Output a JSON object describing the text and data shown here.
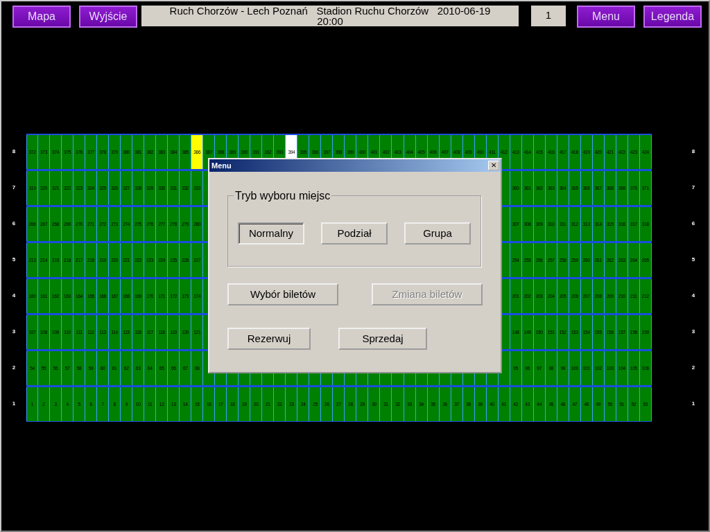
{
  "toolbar": {
    "left_buttons": [
      "Mapa",
      "Wyjście"
    ],
    "event_info": "Ruch Chorzów - Lech Poznań   Stadion Ruchu Chorzów   2010-06-19 20:00",
    "sector": "1",
    "right_buttons": [
      "Menu",
      "Legenda"
    ]
  },
  "seat_rows": [
    {
      "left_label": "8",
      "right_label": "8",
      "left_seats": [
        {
          "number": "372",
          "color": "#008000"
        },
        {
          "number": "373",
          "color": "#008000"
        },
        {
          "number": "374",
          "color": "#008000"
        },
        {
          "number": "375",
          "color": "#008000"
        },
        {
          "number": "376",
          "color": "#008000"
        },
        {
          "number": "377",
          "color": "#008000"
        },
        {
          "number": "378",
          "color": "#008000"
        },
        {
          "number": "379",
          "color": "#008000"
        },
        {
          "number": "380",
          "color": "#008000"
        },
        {
          "number": "381",
          "color": "#008000"
        },
        {
          "number": "382",
          "color": "#008000"
        },
        {
          "number": "383",
          "color": "#008000"
        },
        {
          "number": "384",
          "color": "#008000"
        },
        {
          "number": "385",
          "color": "#008000"
        },
        {
          "number": "386",
          "color": "#ffff00"
        },
        {
          "number": "387",
          "color": "#008000"
        },
        {
          "number": "388",
          "color": "#008000"
        },
        {
          "number": "389",
          "color": "#008000"
        },
        {
          "number": "390",
          "color": "#008000"
        },
        {
          "number": "391",
          "color": "#008000"
        },
        {
          "number": "392",
          "color": "#008000"
        },
        {
          "number": "393",
          "color": "#008000"
        },
        {
          "number": "394",
          "color": "#ffffff"
        },
        {
          "number": "395",
          "color": "#008000"
        },
        {
          "number": "396",
          "color": "#008000"
        },
        {
          "number": "397",
          "color": "#008000"
        },
        {
          "number": "398",
          "color": "#008000"
        },
        {
          "number": "399",
          "color": "#008000"
        },
        {
          "number": "400",
          "color": "#008000"
        },
        {
          "number": "401",
          "color": "#008000"
        },
        {
          "number": "402",
          "color": "#008000"
        },
        {
          "number": "403",
          "color": "#008000"
        },
        {
          "number": "404",
          "color": "#008000"
        },
        {
          "number": "405",
          "color": "#008000"
        },
        {
          "number": "406",
          "color": "#008000"
        },
        {
          "number": "407",
          "color": "#008000"
        },
        {
          "number": "408",
          "color": "#008000"
        },
        {
          "number": "409",
          "color": "#008000"
        },
        {
          "number": "410",
          "color": "#008000"
        },
        {
          "number": "411",
          "color": "#008000"
        },
        {
          "number": "412",
          "color": "#008000"
        },
        {
          "number": "413",
          "color": "#008000"
        },
        {
          "number": "414",
          "color": "#008000"
        },
        {
          "number": "415",
          "color": "#008000"
        },
        {
          "number": "416",
          "color": "#008000"
        },
        {
          "number": "417",
          "color": "#008000"
        },
        {
          "number": "418",
          "color": "#008000"
        },
        {
          "number": "419",
          "color": "#008000"
        },
        {
          "number": "420",
          "color": "#008000"
        },
        {
          "number": "421",
          "color": "#008000"
        },
        {
          "number": "422",
          "color": "#008000"
        },
        {
          "number": "423",
          "color": "#008000"
        },
        {
          "number": "424",
          "color": "#008000"
        }
      ],
      "right_seats": []
    },
    {
      "left_label": "7",
      "right_label": "7",
      "left_seats": [
        {
          "number": "319",
          "color": "#008000"
        },
        {
          "number": "320",
          "color": "#008000"
        },
        {
          "number": "321",
          "color": "#008000"
        },
        {
          "number": "322",
          "color": "#008000"
        },
        {
          "number": "323",
          "color": "#008000"
        },
        {
          "number": "324",
          "color": "#008000"
        },
        {
          "number": "325",
          "color": "#008000"
        },
        {
          "number": "326",
          "color": "#008000"
        },
        {
          "number": "327",
          "color": "#008000"
        },
        {
          "number": "328",
          "color": "#008000"
        },
        {
          "number": "329",
          "color": "#008000"
        },
        {
          "number": "330",
          "color": "#008000"
        },
        {
          "number": "331",
          "color": "#008000"
        },
        {
          "number": "332",
          "color": "#008000"
        },
        {
          "number": "333",
          "color": "#008000"
        }
      ],
      "right_seats": [
        {
          "number": "360",
          "color": "#008000"
        },
        {
          "number": "361",
          "color": "#008000"
        },
        {
          "number": "362",
          "color": "#008000"
        },
        {
          "number": "363",
          "color": "#008000"
        },
        {
          "number": "364",
          "color": "#008000"
        },
        {
          "number": "365",
          "color": "#008000"
        },
        {
          "number": "366",
          "color": "#008000"
        },
        {
          "number": "367",
          "color": "#008000"
        },
        {
          "number": "368",
          "color": "#008000"
        },
        {
          "number": "369",
          "color": "#008000"
        },
        {
          "number": "370",
          "color": "#008000"
        },
        {
          "number": "371",
          "color": "#008000"
        }
      ]
    },
    {
      "left_label": "6",
      "right_label": "6",
      "left_seats": [
        {
          "number": "266",
          "color": "#008000"
        },
        {
          "number": "267",
          "color": "#008000"
        },
        {
          "number": "268",
          "color": "#008000"
        },
        {
          "number": "269",
          "color": "#008000"
        },
        {
          "number": "270",
          "color": "#008000"
        },
        {
          "number": "271",
          "color": "#008000"
        },
        {
          "number": "272",
          "color": "#008000"
        },
        {
          "number": "273",
          "color": "#008000"
        },
        {
          "number": "274",
          "color": "#008000"
        },
        {
          "number": "275",
          "color": "#008000"
        },
        {
          "number": "276",
          "color": "#008000"
        },
        {
          "number": "277",
          "color": "#008000"
        },
        {
          "number": "278",
          "color": "#008000"
        },
        {
          "number": "279",
          "color": "#008000"
        },
        {
          "number": "280",
          "color": "#008000"
        }
      ],
      "right_seats": [
        {
          "number": "307",
          "color": "#008000"
        },
        {
          "number": "308",
          "color": "#008000"
        },
        {
          "number": "309",
          "color": "#008000"
        },
        {
          "number": "310",
          "color": "#008000"
        },
        {
          "number": "311",
          "color": "#008000"
        },
        {
          "number": "312",
          "color": "#008000"
        },
        {
          "number": "313",
          "color": "#008000"
        },
        {
          "number": "314",
          "color": "#008000"
        },
        {
          "number": "315",
          "color": "#008000"
        },
        {
          "number": "316",
          "color": "#008000"
        },
        {
          "number": "317",
          "color": "#008000"
        },
        {
          "number": "318",
          "color": "#008000"
        }
      ]
    },
    {
      "left_label": "5",
      "right_label": "5",
      "left_seats": [
        {
          "number": "213",
          "color": "#008000"
        },
        {
          "number": "214",
          "color": "#008000"
        },
        {
          "number": "215",
          "color": "#008000"
        },
        {
          "number": "216",
          "color": "#008000"
        },
        {
          "number": "217",
          "color": "#008000"
        },
        {
          "number": "218",
          "color": "#008000"
        },
        {
          "number": "219",
          "color": "#008000"
        },
        {
          "number": "220",
          "color": "#008000"
        },
        {
          "number": "221",
          "color": "#008000"
        },
        {
          "number": "222",
          "color": "#008000"
        },
        {
          "number": "223",
          "color": "#008000"
        },
        {
          "number": "224",
          "color": "#008000"
        },
        {
          "number": "225",
          "color": "#008000"
        },
        {
          "number": "226",
          "color": "#008000"
        },
        {
          "number": "227",
          "color": "#008000"
        }
      ],
      "right_seats": [
        {
          "number": "254",
          "color": "#008000"
        },
        {
          "number": "255",
          "color": "#008000"
        },
        {
          "number": "256",
          "color": "#008000"
        },
        {
          "number": "257",
          "color": "#008000"
        },
        {
          "number": "258",
          "color": "#008000"
        },
        {
          "number": "259",
          "color": "#008000"
        },
        {
          "number": "260",
          "color": "#008000"
        },
        {
          "number": "261",
          "color": "#008000"
        },
        {
          "number": "262",
          "color": "#008000"
        },
        {
          "number": "263",
          "color": "#008000"
        },
        {
          "number": "264",
          "color": "#008000"
        },
        {
          "number": "265",
          "color": "#008000"
        }
      ]
    },
    {
      "left_label": "4",
      "right_label": "4",
      "left_seats": [
        {
          "number": "160",
          "color": "#008000"
        },
        {
          "number": "161",
          "color": "#008000"
        },
        {
          "number": "162",
          "color": "#008000"
        },
        {
          "number": "163",
          "color": "#008000"
        },
        {
          "number": "164",
          "color": "#008000"
        },
        {
          "number": "165",
          "color": "#008000"
        },
        {
          "number": "166",
          "color": "#008000"
        },
        {
          "number": "167",
          "color": "#008000"
        },
        {
          "number": "168",
          "color": "#008000"
        },
        {
          "number": "169",
          "color": "#008000"
        },
        {
          "number": "170",
          "color": "#008000"
        },
        {
          "number": "171",
          "color": "#008000"
        },
        {
          "number": "172",
          "color": "#008000"
        },
        {
          "number": "173",
          "color": "#008000"
        },
        {
          "number": "174",
          "color": "#008000"
        }
      ],
      "right_seats": [
        {
          "number": "201",
          "color": "#008000"
        },
        {
          "number": "202",
          "color": "#008000"
        },
        {
          "number": "203",
          "color": "#008000"
        },
        {
          "number": "204",
          "color": "#008000"
        },
        {
          "number": "205",
          "color": "#008000"
        },
        {
          "number": "206",
          "color": "#008000"
        },
        {
          "number": "207",
          "color": "#008000"
        },
        {
          "number": "208",
          "color": "#008000"
        },
        {
          "number": "209",
          "color": "#008000"
        },
        {
          "number": "210",
          "color": "#008000"
        },
        {
          "number": "211",
          "color": "#008000"
        },
        {
          "number": "212",
          "color": "#008000"
        }
      ]
    },
    {
      "left_label": "3",
      "right_label": "3",
      "left_seats": [
        {
          "number": "107",
          "color": "#008000"
        },
        {
          "number": "108",
          "color": "#008000"
        },
        {
          "number": "109",
          "color": "#008000"
        },
        {
          "number": "110",
          "color": "#008000"
        },
        {
          "number": "111",
          "color": "#008000"
        },
        {
          "number": "112",
          "color": "#008000"
        },
        {
          "number": "113",
          "color": "#008000"
        },
        {
          "number": "114",
          "color": "#008000"
        },
        {
          "number": "115",
          "color": "#008000"
        },
        {
          "number": "116",
          "color": "#008000"
        },
        {
          "number": "117",
          "color": "#008000"
        },
        {
          "number": "118",
          "color": "#008000"
        },
        {
          "number": "119",
          "color": "#008000"
        },
        {
          "number": "120",
          "color": "#008000"
        },
        {
          "number": "121",
          "color": "#008000"
        }
      ],
      "right_seats": [
        {
          "number": "148",
          "color": "#008000"
        },
        {
          "number": "149",
          "color": "#008000"
        },
        {
          "number": "150",
          "color": "#008000"
        },
        {
          "number": "151",
          "color": "#008000"
        },
        {
          "number": "152",
          "color": "#008000"
        },
        {
          "number": "153",
          "color": "#008000"
        },
        {
          "number": "154",
          "color": "#008000"
        },
        {
          "number": "155",
          "color": "#008000"
        },
        {
          "number": "156",
          "color": "#008000"
        },
        {
          "number": "157",
          "color": "#008000"
        },
        {
          "number": "158",
          "color": "#008000"
        },
        {
          "number": "159",
          "color": "#008000"
        }
      ]
    },
    {
      "left_label": "2",
      "right_label": "2",
      "left_seats": [
        {
          "number": "54",
          "color": "#008000"
        },
        {
          "number": "55",
          "color": "#008000"
        },
        {
          "number": "56",
          "color": "#008000"
        },
        {
          "number": "57",
          "color": "#008000"
        },
        {
          "number": "58",
          "color": "#008000"
        },
        {
          "number": "59",
          "color": "#008000"
        },
        {
          "number": "60",
          "color": "#008000"
        },
        {
          "number": "61",
          "color": "#008000"
        },
        {
          "number": "62",
          "color": "#008000"
        },
        {
          "number": "63",
          "color": "#008000"
        },
        {
          "number": "64",
          "color": "#008000"
        },
        {
          "number": "65",
          "color": "#008000"
        },
        {
          "number": "66",
          "color": "#008000"
        },
        {
          "number": "67",
          "color": "#008000"
        },
        {
          "number": "68",
          "color": "#008000"
        }
      ],
      "right_seats": [
        {
          "number": "95",
          "color": "#008000"
        },
        {
          "number": "96",
          "color": "#008000"
        },
        {
          "number": "97",
          "color": "#008000"
        },
        {
          "number": "98",
          "color": "#008000"
        },
        {
          "number": "99",
          "color": "#008000"
        },
        {
          "number": "100",
          "color": "#008000"
        },
        {
          "number": "101",
          "color": "#008000"
        },
        {
          "number": "102",
          "color": "#008000"
        },
        {
          "number": "103",
          "color": "#008000"
        },
        {
          "number": "104",
          "color": "#008000"
        },
        {
          "number": "105",
          "color": "#008000"
        },
        {
          "number": "106",
          "color": "#008000"
        }
      ]
    },
    {
      "left_label": "1",
      "right_label": "1",
      "left_seats": [
        {
          "number": "1",
          "color": "#008000"
        },
        {
          "number": "2",
          "color": "#008000"
        },
        {
          "number": "3",
          "color": "#008000"
        },
        {
          "number": "4",
          "color": "#008000"
        },
        {
          "number": "5",
          "color": "#008000"
        },
        {
          "number": "6",
          "color": "#008000"
        },
        {
          "number": "7",
          "color": "#008000"
        },
        {
          "number": "8",
          "color": "#008000"
        },
        {
          "number": "9",
          "color": "#008000"
        },
        {
          "number": "10",
          "color": "#008000"
        },
        {
          "number": "11",
          "color": "#008000"
        },
        {
          "number": "12",
          "color": "#008000"
        },
        {
          "number": "13",
          "color": "#008000"
        },
        {
          "number": "14",
          "color": "#008000"
        },
        {
          "number": "15",
          "color": "#008000"
        },
        {
          "number": "16",
          "color": "#008000"
        },
        {
          "number": "17",
          "color": "#008000"
        },
        {
          "number": "18",
          "color": "#008000"
        },
        {
          "number": "19",
          "color": "#008000"
        },
        {
          "number": "20",
          "color": "#008000"
        },
        {
          "number": "21",
          "color": "#008000"
        },
        {
          "number": "22",
          "color": "#008000"
        },
        {
          "number": "23",
          "color": "#008000"
        },
        {
          "number": "24",
          "color": "#008000"
        },
        {
          "number": "25",
          "color": "#008000"
        },
        {
          "number": "26",
          "color": "#008000"
        },
        {
          "number": "27",
          "color": "#008000"
        },
        {
          "number": "28",
          "color": "#008000"
        },
        {
          "number": "29",
          "color": "#008000"
        },
        {
          "number": "30",
          "color": "#008000"
        },
        {
          "number": "31",
          "color": "#008000"
        },
        {
          "number": "32",
          "color": "#008000"
        },
        {
          "number": "33",
          "color": "#008000"
        },
        {
          "number": "34",
          "color": "#008000"
        },
        {
          "number": "35",
          "color": "#008000"
        },
        {
          "number": "36",
          "color": "#008000"
        },
        {
          "number": "37",
          "color": "#008000"
        },
        {
          "number": "38",
          "color": "#008000"
        },
        {
          "number": "39",
          "color": "#008000"
        },
        {
          "number": "40",
          "color": "#008000"
        },
        {
          "number": "41",
          "color": "#008000"
        },
        {
          "number": "42",
          "color": "#008000"
        },
        {
          "number": "43",
          "color": "#008000"
        },
        {
          "number": "44",
          "color": "#008000"
        },
        {
          "number": "45",
          "color": "#008000"
        },
        {
          "number": "46",
          "color": "#008000"
        },
        {
          "number": "47",
          "color": "#008000"
        },
        {
          "number": "48",
          "color": "#008000"
        },
        {
          "number": "49",
          "color": "#008000"
        },
        {
          "number": "50",
          "color": "#008000"
        },
        {
          "number": "51",
          "color": "#008000"
        },
        {
          "number": "52",
          "color": "#008000"
        },
        {
          "number": "53",
          "color": "#008000"
        }
      ],
      "right_seats": []
    }
  ],
  "dialog": {
    "title": "Menu",
    "close": "✕",
    "group_title": "Tryb wyboru miejsc",
    "modes": [
      {
        "label": "Normalny",
        "selected": true
      },
      {
        "label": "Podział",
        "selected": false
      },
      {
        "label": "Grupa",
        "selected": false
      }
    ],
    "action_rows": [
      [
        {
          "label": "Wybór biletów",
          "disabled": false
        },
        {
          "label": "Zmiana biletów",
          "disabled": true
        }
      ],
      [
        {
          "label": "Rezerwuj",
          "disabled": false
        },
        {
          "label": "Sprzedaj",
          "disabled": false
        }
      ]
    ]
  }
}
